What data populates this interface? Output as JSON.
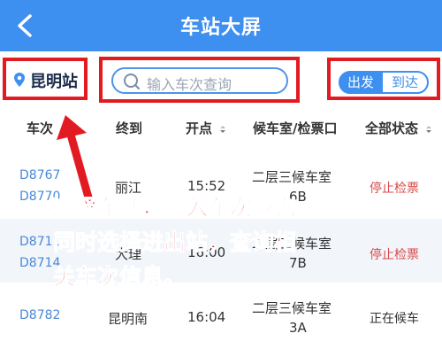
{
  "header": {
    "title": "车站大屏"
  },
  "toolbar": {
    "station": "昆明站",
    "search_placeholder": "输入车次查询",
    "toggle": {
      "depart": "出发",
      "arrive": "到达",
      "active": "depart"
    }
  },
  "table": {
    "columns": [
      "车次",
      "终到",
      "开点",
      "候车室/检票口",
      "全部状态"
    ],
    "rows": [
      {
        "trains": [
          "D8767",
          "D8770"
        ],
        "destination": "丽江",
        "departure": "15:52",
        "room": [
          "二层三候车室",
          "6B"
        ],
        "status": "停止检票"
      },
      {
        "trains": [
          "D8711",
          "D8714"
        ],
        "destination": "大理",
        "departure": "16:00",
        "room": [
          "二层三候车室",
          "7B"
        ],
        "status": "停止检票"
      },
      {
        "trains": [
          "D8782",
          ""
        ],
        "destination": "昆明南",
        "departure": "16:04",
        "room": [
          "二层三候车室",
          "3A"
        ],
        "status": "正在候车"
      }
    ]
  },
  "annotation": {
    "lines": [
      "选择车站，输入车次查询。",
      "同时选择进出站，查询相",
      "关车次信息。"
    ]
  },
  "colors": {
    "header": "#3d8ff0",
    "highlight": "#e21b23",
    "train_link": "#4a88d8",
    "status_stop": "#d84a4a"
  }
}
